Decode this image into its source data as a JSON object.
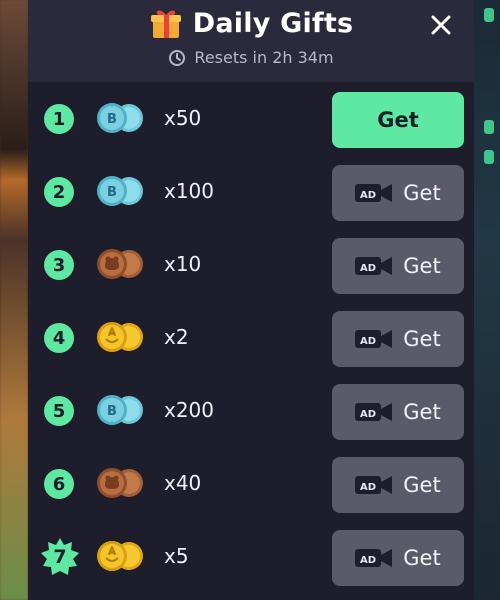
{
  "header": {
    "title": "Daily Gifts",
    "reset_text": "Resets in 2h 34m",
    "gift_icon": "gift-icon",
    "close_icon": "close-icon"
  },
  "colors": {
    "accent": "#5ee8a1",
    "panel_bg": "#1e1d2c",
    "header_bg": "#2a2a3c",
    "ad_button_bg": "#5b5a69"
  },
  "gifts": [
    {
      "day": "1",
      "reward": "blue-gem-coins",
      "amount": "x50",
      "button_label": "Get",
      "requires_ad": false
    },
    {
      "day": "2",
      "reward": "blue-gem-coins",
      "amount": "x100",
      "button_label": "Get",
      "requires_ad": true,
      "ad_label": "AD"
    },
    {
      "day": "3",
      "reward": "bronze-coins",
      "amount": "x10",
      "button_label": "Get",
      "requires_ad": true,
      "ad_label": "AD"
    },
    {
      "day": "4",
      "reward": "gold-coins",
      "amount": "x2",
      "button_label": "Get",
      "requires_ad": true,
      "ad_label": "AD"
    },
    {
      "day": "5",
      "reward": "blue-gem-coins",
      "amount": "x200",
      "button_label": "Get",
      "requires_ad": true,
      "ad_label": "AD"
    },
    {
      "day": "6",
      "reward": "bronze-coins",
      "amount": "x40",
      "button_label": "Get",
      "requires_ad": true,
      "ad_label": "AD"
    },
    {
      "day": "7",
      "reward": "gold-coins",
      "amount": "x5",
      "button_label": "Get",
      "requires_ad": true,
      "ad_label": "AD"
    }
  ]
}
